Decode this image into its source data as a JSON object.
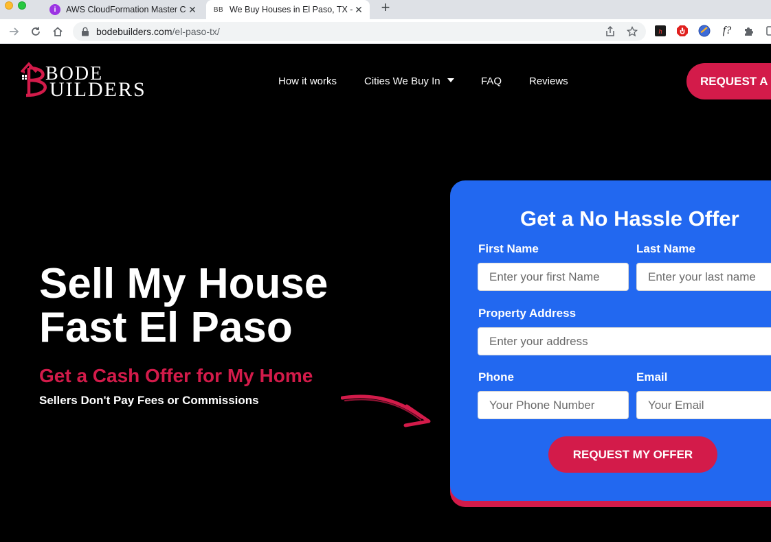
{
  "browser": {
    "tabs": [
      {
        "title": "AWS CloudFormation Master C",
        "favicon": "aws-favicon-icon",
        "active": false
      },
      {
        "title": "We Buy Houses in El Paso, TX -",
        "favicon_text": "BB",
        "active": true
      }
    ],
    "url_host": "bodebuilders.com",
    "url_path": "/el-paso-tx/"
  },
  "site": {
    "logo": {
      "line1": "BODE",
      "line2": "UILDERS"
    },
    "nav": {
      "how_it_works": "How it works",
      "cities": "Cities We Buy In",
      "faq": "FAQ",
      "reviews": "Reviews"
    },
    "cta": "REQUEST A"
  },
  "hero": {
    "title_line1": "Sell My House",
    "title_line2": "Fast El Paso",
    "subtitle": "Get a Cash Offer for My Home",
    "note": "Sellers Don't Pay Fees or Commissions"
  },
  "form": {
    "title": "Get a No Hassle Offer",
    "first_name": {
      "label": "First Name",
      "placeholder": "Enter your first Name"
    },
    "last_name": {
      "label": "Last Name",
      "placeholder": "Enter your last name"
    },
    "address": {
      "label": "Property Address",
      "placeholder": "Enter your address"
    },
    "phone": {
      "label": "Phone",
      "placeholder": "Your Phone Number"
    },
    "email": {
      "label": "Email",
      "placeholder": "Your Email"
    },
    "submit": "REQUEST MY OFFER"
  },
  "colors": {
    "accent_red": "#d31b4a",
    "form_blue": "#2268f0",
    "background": "#000000"
  }
}
